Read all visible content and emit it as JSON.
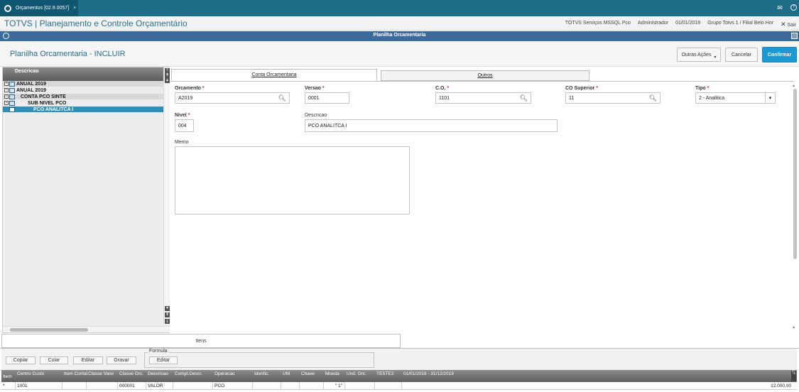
{
  "topbar": {
    "tab_label": "Orçamentos [02.9.0057]",
    "tab_close": "×",
    "mail_icon": "mail-icon",
    "help_icon": "help-icon"
  },
  "app": {
    "title": "TOTVS | Planejamento e Controle Orçamentário",
    "info": [
      "TOTVS Serviços MSSQL Pco",
      "Administrador",
      "01/01/2019",
      "Grupo Totvs 1 / Filial Belo Hor"
    ],
    "exit_label": "Sair"
  },
  "window": {
    "title": "Planilha Orcamentaria"
  },
  "header": {
    "title": "Planilha Orcamentaria - INCLUIR",
    "actions_label": "Outras Ações",
    "cancel_label": "Cancelar",
    "confirm_label": "Confirmar"
  },
  "tree": {
    "header": "Descricao",
    "items": [
      {
        "label": "ANUAL 2019",
        "toggle": "-"
      },
      {
        "label": "ANUAL 2019",
        "toggle": "-"
      },
      {
        "label": "CONTA PCO SINTE",
        "toggle": "-"
      },
      {
        "label": "SUB NIVEL PCO",
        "toggle": "-"
      },
      {
        "label": "PCO ANALITCA I",
        "toggle": ""
      }
    ]
  },
  "tabs": {
    "main": "Conta Orcamentaria",
    "other": "Outros"
  },
  "form": {
    "orcamento": {
      "label": "Orcamento",
      "req": "*",
      "value": "A2019"
    },
    "versao": {
      "label": "Versao",
      "req": "*",
      "value": "0001"
    },
    "co": {
      "label": "C.O.",
      "req": "*",
      "value": "1101"
    },
    "co_superior": {
      "label": "CO Superior",
      "req": "*",
      "value": "11"
    },
    "tipo": {
      "label": "Tipo",
      "req": "*",
      "value": "2 - Analitica"
    },
    "nivel": {
      "label": "Nivel",
      "req": "*",
      "value": "004"
    },
    "descricao": {
      "label": "Descricao",
      "value": "PCO ANALITCA I"
    },
    "memo": {
      "label": "Memo",
      "value": ""
    }
  },
  "bottom": {
    "itens_tab": "Itens",
    "copiar": "Copiar",
    "colar": "Colar",
    "editar": "Editar",
    "gravar": "Gravar",
    "formula_legend": "Formula",
    "formula_edit": "Editar"
  },
  "grid": {
    "headers": [
      "Item",
      "Centro Custo",
      "Item Contal",
      "Classe Valor",
      "Classe Orc.",
      "Descricao",
      "Compl.Descr.",
      "Operacao",
      "Idenfic.",
      "UM",
      "Chave",
      "Moeda",
      "Und. Orc.",
      "TESTE2",
      "01/01/2019 - 31/12/2019"
    ],
    "row": [
      "*",
      "1001",
      "",
      "",
      "000001",
      "VALOR",
      "",
      "PCO",
      "",
      "",
      "",
      "\" 1\"",
      "",
      "",
      "12.000,00"
    ]
  }
}
